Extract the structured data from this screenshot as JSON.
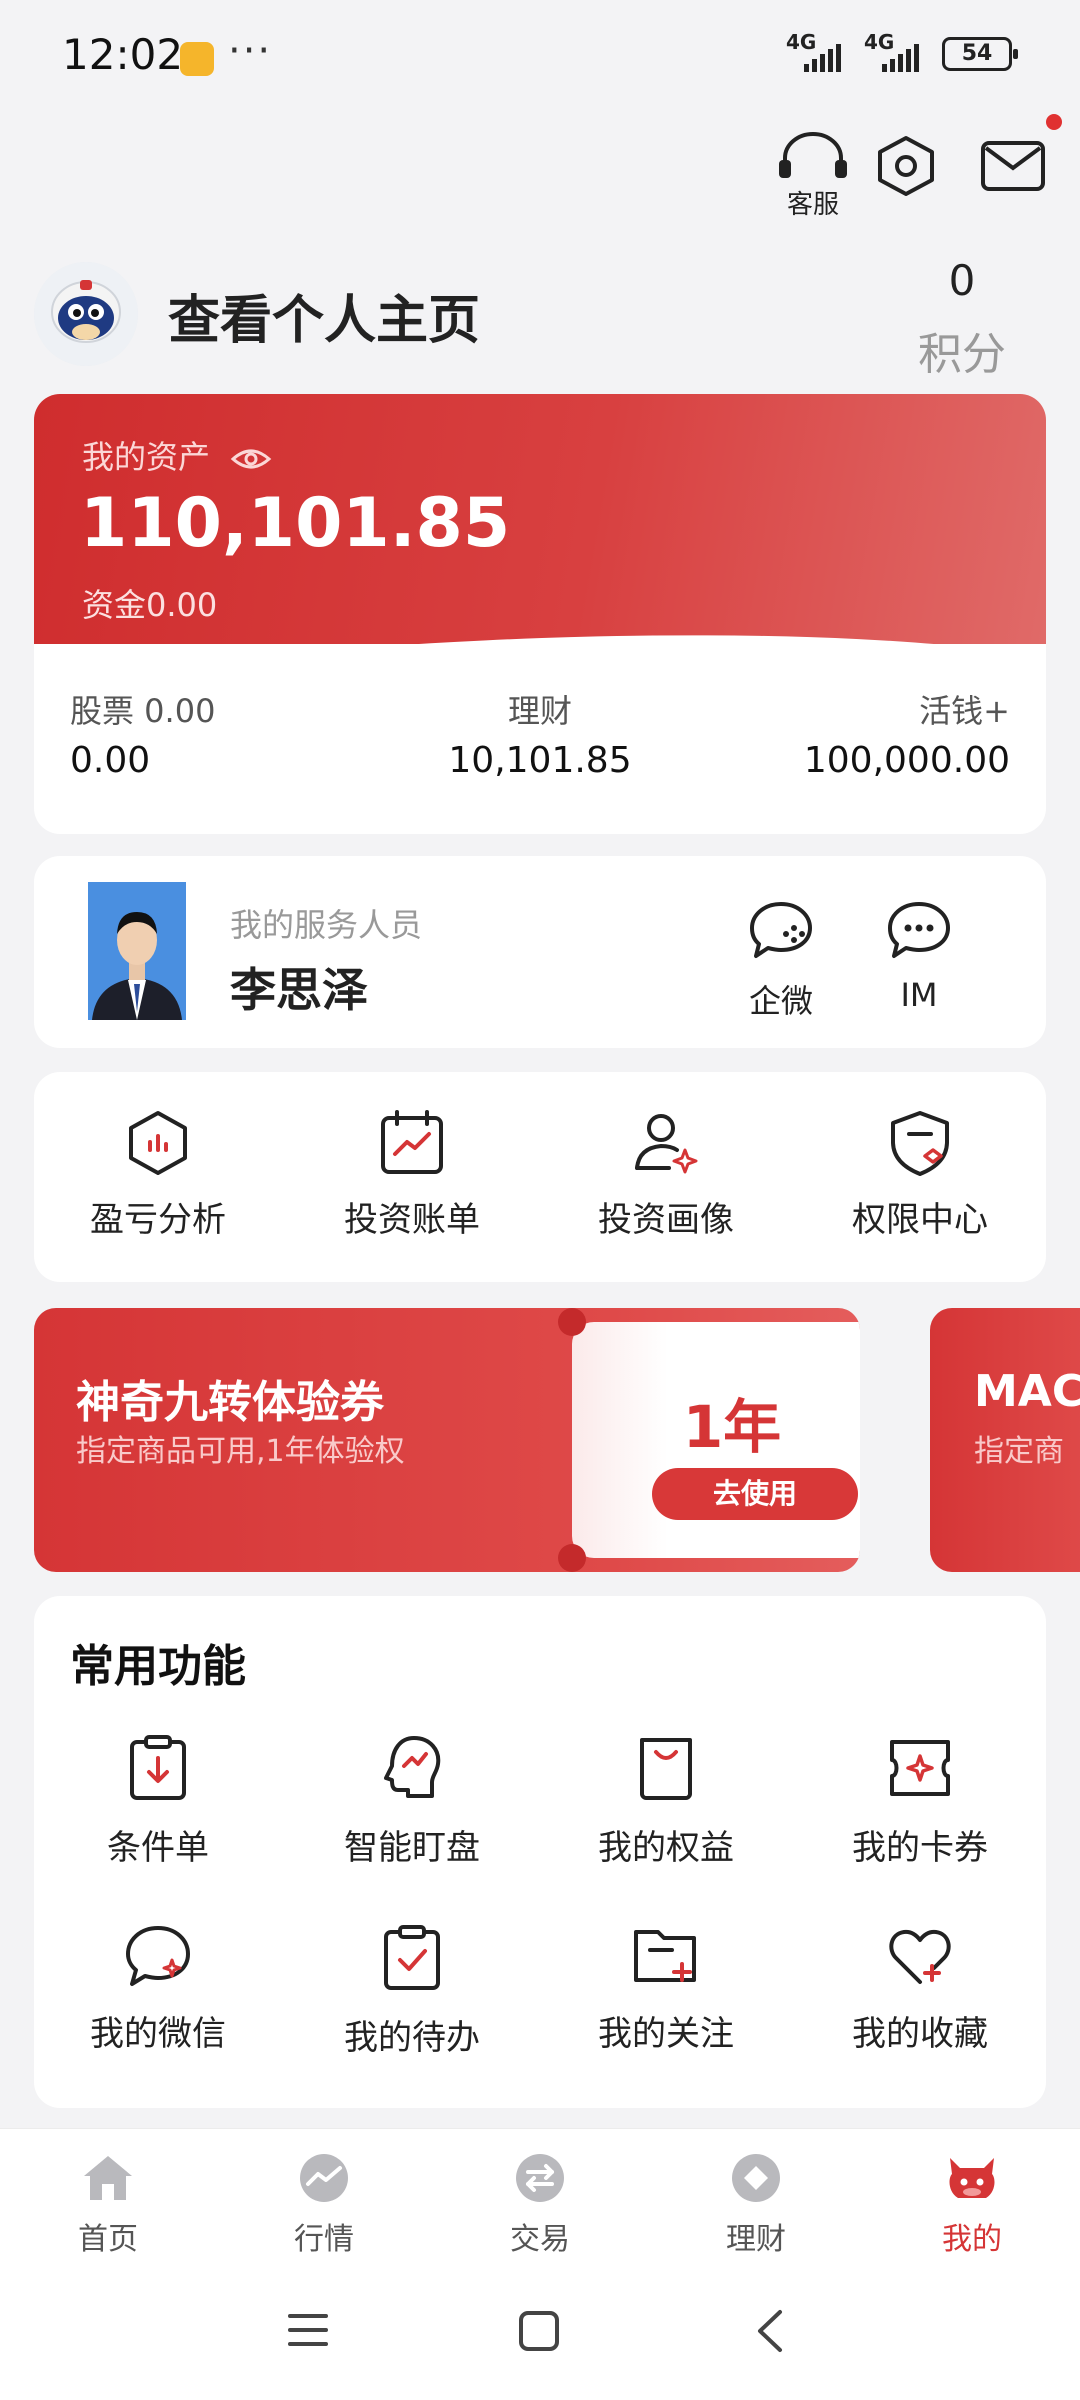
{
  "status_bar": {
    "time": "12:02",
    "dots": "···",
    "net1": "4G",
    "net2": "4G",
    "battery": "54"
  },
  "header": {
    "customer_service_label": "客服"
  },
  "profile": {
    "title": "查看个人主页",
    "points_value": "0",
    "points_label": "积分"
  },
  "assets": {
    "label": "我的资产",
    "amount": "110,101.85",
    "fund_label": "资金",
    "fund_value": "0.00",
    "stocks_label": "股票 0.00",
    "stocks_value": "0.00",
    "wealth_label": "理财",
    "wealth_value": "10,101.85",
    "cash_label": "活钱+",
    "cash_value": "100,000.00"
  },
  "service_person": {
    "role": "我的服务人员",
    "name": "李思泽",
    "wecom_label": "企微",
    "im_label": "IM"
  },
  "quick_tools": [
    {
      "label": "盈亏分析",
      "icon": "hexagon-chart-icon"
    },
    {
      "label": "投资账单",
      "icon": "calendar-trend-icon"
    },
    {
      "label": "投资画像",
      "icon": "user-sparkle-icon"
    },
    {
      "label": "权限中心",
      "icon": "shield-icon"
    }
  ],
  "coupon": {
    "title": "神奇九转体验券",
    "desc": "指定商品可用,1年体验权",
    "duration": "1年",
    "use_button": "去使用",
    "next_title": "MAC",
    "next_desc": "指定商"
  },
  "common_functions": {
    "title": "常用功能",
    "items": [
      {
        "label": "条件单",
        "icon": "clipboard-down-icon"
      },
      {
        "label": "智能盯盘",
        "icon": "head-chart-icon"
      },
      {
        "label": "我的权益",
        "icon": "bag-icon"
      },
      {
        "label": "我的卡券",
        "icon": "ticket-icon"
      },
      {
        "label": "我的微信",
        "icon": "chat-bubble-icon"
      },
      {
        "label": "我的待办",
        "icon": "clipboard-check-icon"
      },
      {
        "label": "我的关注",
        "icon": "folder-plus-icon"
      },
      {
        "label": "我的收藏",
        "icon": "heart-plus-icon"
      }
    ]
  },
  "bottom_nav": [
    {
      "label": "首页",
      "active": false
    },
    {
      "label": "行情",
      "active": false
    },
    {
      "label": "交易",
      "active": false
    },
    {
      "label": "理财",
      "active": false
    },
    {
      "label": "我的",
      "active": true
    }
  ],
  "colors": {
    "brand_red": "#d53536",
    "background": "#f3f3f5"
  }
}
